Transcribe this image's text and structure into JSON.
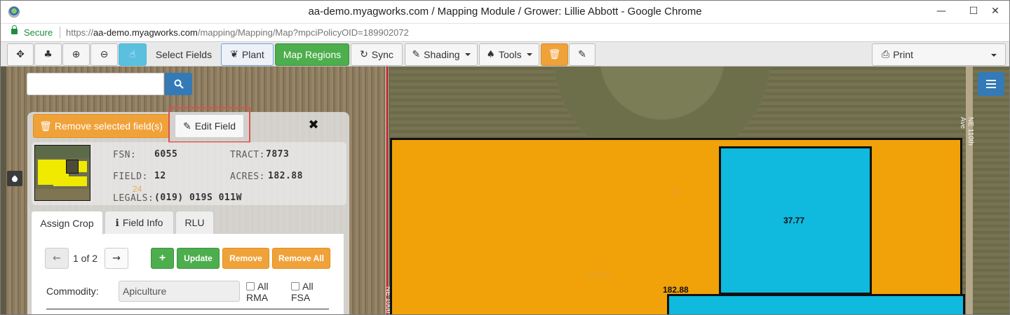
{
  "window": {
    "title": "aa-demo.myagworks.com / Mapping Module / Grower: Lillie Abbott - Google Chrome",
    "minimize": "—",
    "maximize": "☐",
    "close": "✕"
  },
  "address_bar": {
    "secure_label": "Secure",
    "url_scheme": "https://",
    "url_host": "aa-demo.myagworks.com",
    "url_path": "/mapping/Mapping/Map?mpciPolicyOID=189902072"
  },
  "toolbar": {
    "pan_icon": "✥",
    "tree_icon": "♣",
    "zoom_in_icon": "⊕",
    "zoom_out_icon": "⊖",
    "select_icon": "☝",
    "select_fields_label": "Select Fields",
    "plant_icon": "❦",
    "plant_label": "Plant",
    "map_regions_label": "Map Regions",
    "sync_icon": "↻",
    "sync_label": "Sync",
    "shading_icon": "✎",
    "shading_label": "Shading",
    "tools_icon": "♠",
    "tools_label": "Tools",
    "trash_icon": "🗑",
    "edit_icon": "✎",
    "print_icon": "⎙",
    "print_label": "Print"
  },
  "panel": {
    "remove_selected_icon": "🗑",
    "remove_selected_label": "Remove selected field(s)",
    "edit_field_icon": "✎",
    "edit_field_label": "Edit Field",
    "close_icon": "✖",
    "fsn_key": "FSN:",
    "fsn_value": "6055",
    "tract_key": "TRACT:",
    "tract_value": "7873",
    "field_key": "FIELD:",
    "field_value": "12",
    "acres_key": "ACRES:",
    "acres_value": "182.88",
    "legals_key": "LEGALS:",
    "legals_value": "(019) 019S 011W",
    "tabs": {
      "assign_crop": "Assign Crop",
      "field_info_icon": "ℹ",
      "field_info": "Field Info",
      "rlu": "RLU"
    },
    "pager": {
      "prev_icon": "←",
      "indicator": "1 of 2",
      "next_icon": "→"
    },
    "actions": {
      "add": "+",
      "update": "Update",
      "remove": "Remove",
      "remove_all": "Remove All"
    },
    "commodity_label": "Commodity:",
    "commodity_value": "Apiculture",
    "all_rma": "All RMA",
    "all_rma_line1": "All",
    "all_rma_line2": "RMA",
    "all_fsa_line1": "All",
    "all_fsa_line2": "FSA"
  },
  "map": {
    "street_right": "NE 110th Ave",
    "street_left": "NE 100th",
    "field_big_ghost_label": "18",
    "field_big_ghost_acres": "182.88",
    "field_big_acres": "182.88",
    "field_blue_acres": "37.77",
    "ghost_label_left": "24",
    "colors": {
      "crop_field": "#f0a208",
      "blue_field": "#10b9de",
      "selection": "#c8102e"
    }
  }
}
